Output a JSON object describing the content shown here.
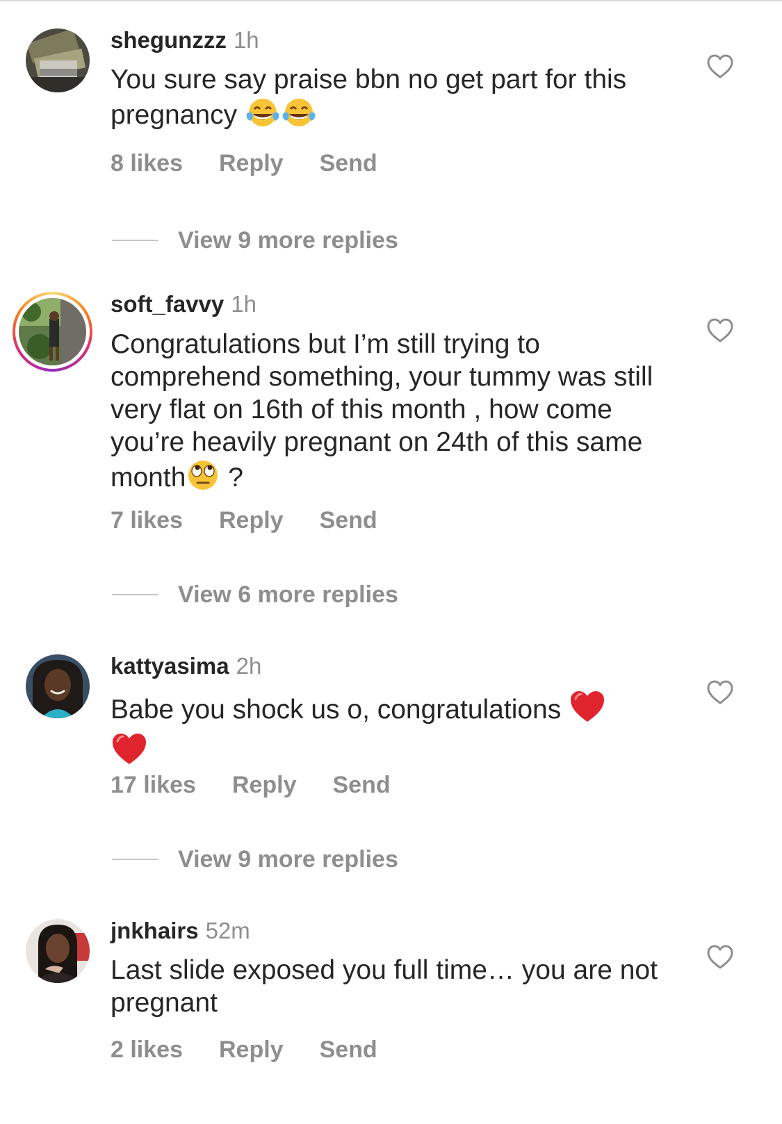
{
  "comments": [
    {
      "username": "shegunzzz",
      "time": "1h",
      "text": "You sure say praise bbn no get part for this pregnancy ",
      "emojis": [
        "face-with-tears-of-joy",
        "face-with-tears-of-joy"
      ],
      "likes": "8 likes",
      "reply_label": "Reply",
      "send_label": "Send",
      "view_replies": "View 9 more replies",
      "has_story_ring": false
    },
    {
      "username": "soft_favvy",
      "time": "1h",
      "text": "Congratulations but I’m still trying to comprehend something, your tummy was still very flat on 16th of this month , how come you’re heavily pregnant on 24th of this same month",
      "text_suffix": " ?",
      "emojis": [
        "face-with-rolling-eyes"
      ],
      "likes": "7 likes",
      "reply_label": "Reply",
      "send_label": "Send",
      "view_replies": "View 6 more replies",
      "has_story_ring": true
    },
    {
      "username": "kattyasima",
      "time": "2h",
      "text": "Babe you shock us o, congratulations ",
      "emojis": [
        "red-heart",
        "red-heart"
      ],
      "likes": "17 likes",
      "reply_label": "Reply",
      "send_label": "Send",
      "view_replies": "View 9 more replies",
      "has_story_ring": false
    },
    {
      "username": "jnkhairs",
      "time": "52m",
      "text": "Last slide exposed you full time… you are not pregnant",
      "emojis": [],
      "likes": "2 likes",
      "reply_label": "Reply",
      "send_label": "Send",
      "has_story_ring": false
    }
  ],
  "icons": {
    "like": "heart-outline-icon"
  },
  "colors": {
    "text_primary": "#262626",
    "text_secondary": "#8e8e8e",
    "heart_red": "#e0242d",
    "emoji_yellow": "#f8c437"
  }
}
